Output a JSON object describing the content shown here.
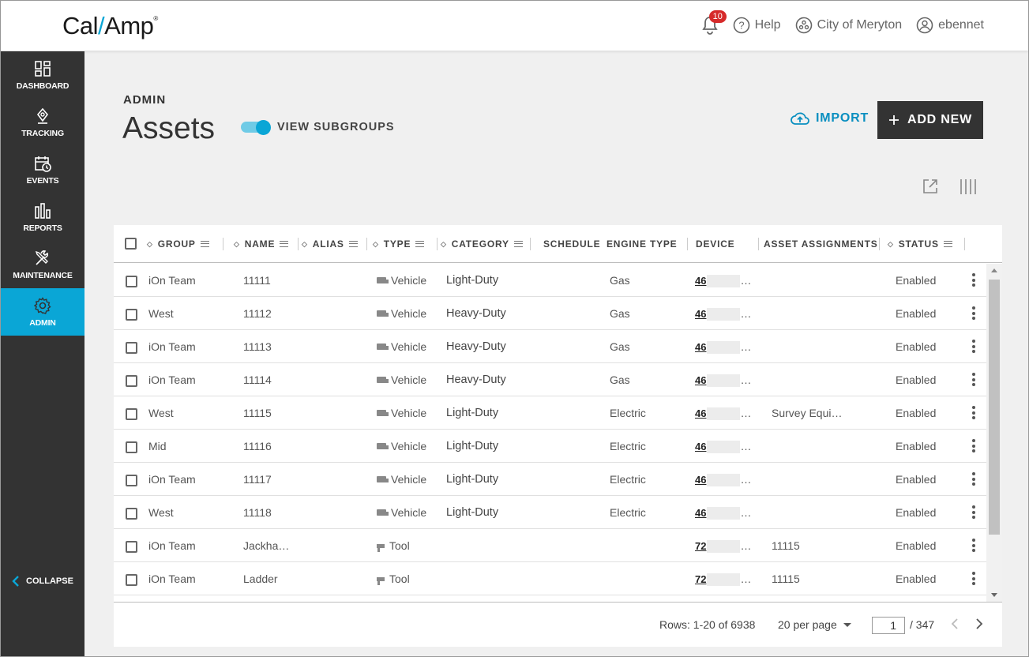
{
  "brand": {
    "name_left": "Cal",
    "name_right": "Amp",
    "mark": "®",
    "accent": "#0aa6d6"
  },
  "topnav": {
    "notifications": {
      "icon": "bell-icon",
      "count": "10"
    },
    "help": {
      "icon": "help-circle-icon",
      "label": "Help"
    },
    "org": {
      "icon": "org-icon",
      "label": "City of Meryton"
    },
    "user": {
      "icon": "user-icon",
      "label": "ebennet"
    }
  },
  "sidebar": {
    "items": [
      {
        "label": "DASHBOARD",
        "icon": "dashboard-icon"
      },
      {
        "label": "TRACKING",
        "icon": "location-pin-icon"
      },
      {
        "label": "EVENTS",
        "icon": "calendar-clock-icon"
      },
      {
        "label": "REPORTS",
        "icon": "bar-chart-icon"
      },
      {
        "label": "MAINTENANCE",
        "icon": "tools-icon"
      },
      {
        "label": "ADMIN",
        "icon": "gear-icon",
        "active": true
      }
    ],
    "collapse_label": "COLLAPSE"
  },
  "page": {
    "eyebrow": "ADMIN",
    "title": "Assets",
    "toggle_label": "VIEW SUBGROUPS",
    "toggle_on": true,
    "import_label": "IMPORT",
    "add_new_label": "ADD NEW"
  },
  "table": {
    "columns": [
      "GROUP",
      "NAME",
      "ALIAS",
      "TYPE",
      "CATEGORY",
      "SCHEDULE",
      "ENGINE TYPE",
      "DEVICE",
      "ASSET ASSIGNMENTS",
      "STATUS"
    ],
    "rows": [
      {
        "group": "iOn Team",
        "name": "11111",
        "type": "Vehicle",
        "category": "Light-Duty",
        "engine": "Gas",
        "device": "46",
        "assignment": "",
        "status": "Enabled"
      },
      {
        "group": "West",
        "name": "11112",
        "type": "Vehicle",
        "category": "Heavy-Duty",
        "engine": "Gas",
        "device": "46",
        "assignment": "",
        "status": "Enabled"
      },
      {
        "group": "iOn Team",
        "name": "11113",
        "type": "Vehicle",
        "category": "Heavy-Duty",
        "engine": "Gas",
        "device": "46",
        "assignment": "",
        "status": "Enabled"
      },
      {
        "group": "iOn Team",
        "name": "11114",
        "type": "Vehicle",
        "category": "Heavy-Duty",
        "engine": "Gas",
        "device": "46",
        "assignment": "",
        "status": "Enabled"
      },
      {
        "group": "West",
        "name": "11115",
        "type": "Vehicle",
        "category": "Light-Duty",
        "engine": "Electric",
        "device": "46",
        "assignment": "Survey Equi…",
        "status": "Enabled"
      },
      {
        "group": "Mid",
        "name": "11116",
        "type": "Vehicle",
        "category": "Light-Duty",
        "engine": "Electric",
        "device": "46",
        "assignment": "",
        "status": "Enabled"
      },
      {
        "group": "iOn Team",
        "name": "11117",
        "type": "Vehicle",
        "category": "Light-Duty",
        "engine": "Electric",
        "device": "46",
        "assignment": "",
        "status": "Enabled"
      },
      {
        "group": "West",
        "name": "11118",
        "type": "Vehicle",
        "category": "Light-Duty",
        "engine": "Electric",
        "device": "46",
        "assignment": "",
        "status": "Enabled"
      },
      {
        "group": "iOn Team",
        "name": "Jackha…",
        "type": "Tool",
        "category": "",
        "engine": "",
        "device": "72",
        "assignment": "11115",
        "status": "Enabled"
      },
      {
        "group": "iOn Team",
        "name": "Ladder",
        "type": "Tool",
        "category": "",
        "engine": "",
        "device": "72",
        "assignment": "11115",
        "status": "Enabled"
      }
    ]
  },
  "pagination": {
    "rows_info": "Rows: 1-20 of 6938",
    "per_page": "20 per page",
    "current_page": "1",
    "total_pages": "/ 347"
  }
}
